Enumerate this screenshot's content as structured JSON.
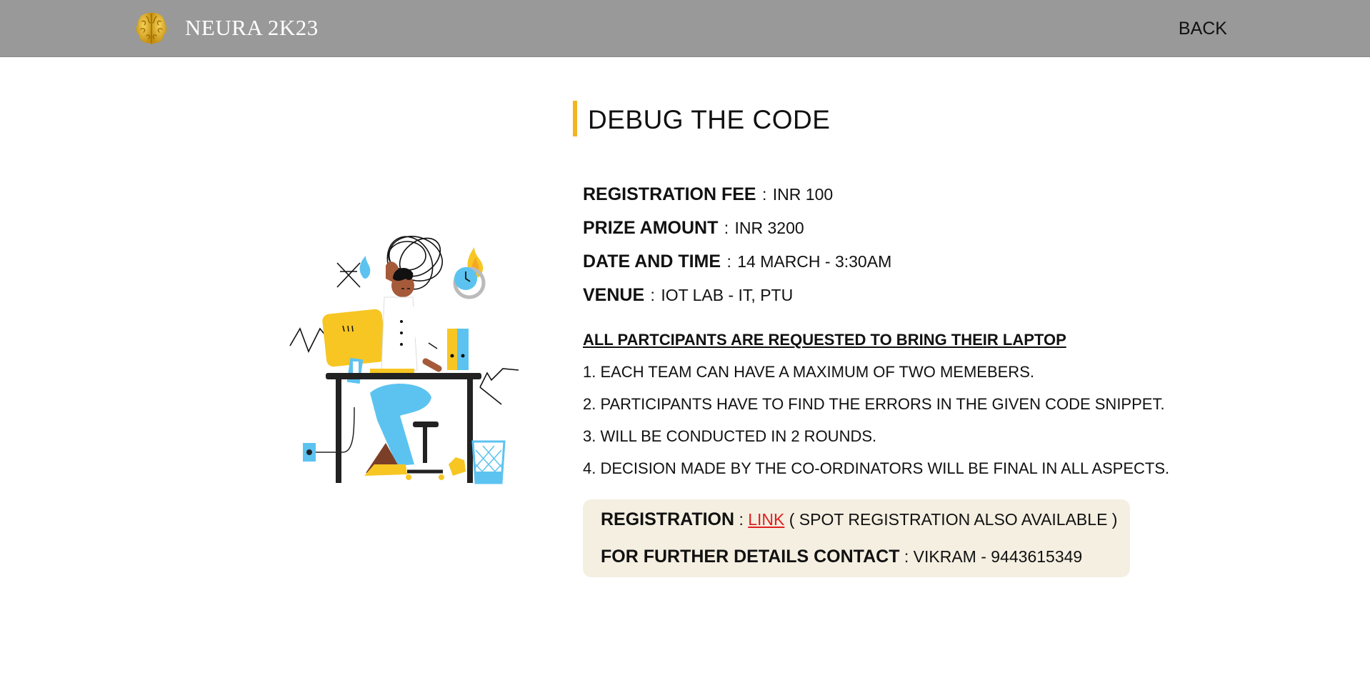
{
  "navbar": {
    "brand": "NEURA 2K23",
    "back_label": "BACK",
    "logo_icon": "golden-brain-icon",
    "background": "#999999"
  },
  "event": {
    "title": "DEBUG THE CODE",
    "accent_color": "#f4b522",
    "registration_fee_label": "REGISTRATION FEE",
    "registration_fee_value": "INR 100",
    "prize_amount_label": "PRIZE AMOUNT",
    "prize_amount_value": "INR 3200",
    "date_time_label": "DATE AND TIME",
    "date_time_value": "14 MARCH - 3:30AM",
    "venue_label": "VENUE",
    "venue_value": "IOT LAB - IT, PTU",
    "separator": ":",
    "notice": "ALL PARTCIPANTS ARE REQUESTED TO BRING THEIR LAPTOP",
    "rules": [
      "1. EACH TEAM CAN HAVE A MAXIMUM OF TWO MEMEBERS.",
      "2. PARTICIPANTS HAVE TO FIND THE ERRORS IN THE GIVEN CODE SNIPPET.",
      "3. WILL BE CONDUCTED IN 2 ROUNDS.",
      "4. DECISION MADE BY THE CO-ORDINATORS WILL BE FINAL IN ALL ASPECTS."
    ]
  },
  "registration": {
    "label": "REGISTRATION",
    "link_label": "LINK",
    "note": "( SPOT REGISTRATION ALSO AVAILABLE )",
    "contact_label": "FOR FURTHER DETAILS CONTACT",
    "contact_value": "VIKRAM - 9443615349",
    "box_color": "#f4efe1",
    "link_color": "#e02020"
  },
  "illustration": {
    "icon": "stressed-programmer-at-desk-illustration"
  }
}
